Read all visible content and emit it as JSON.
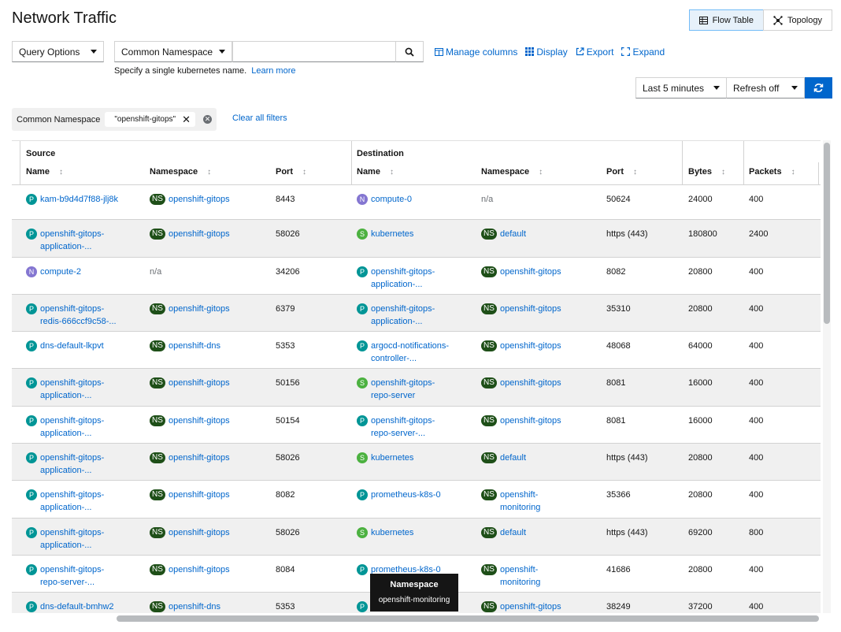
{
  "page": {
    "title": "Network Traffic"
  },
  "views": {
    "flow_table": "Flow Table",
    "topology": "Topology"
  },
  "toolbar": {
    "query_options": "Query Options",
    "filter_field": "Common Namespace",
    "search_value": "",
    "helper_text": "Specify a single kubernetes name.",
    "learn_more": "Learn more",
    "manage_columns": "Manage columns",
    "display": "Display",
    "export": "Export",
    "expand": "Expand"
  },
  "time": {
    "range": "Last 5 minutes",
    "refresh": "Refresh off"
  },
  "filters": {
    "group_label": "Common Namespace",
    "chip_value": "\"openshift-gitops\"",
    "clear_all": "Clear all filters"
  },
  "table": {
    "group_source": "Source",
    "group_destination": "Destination",
    "headers": {
      "src_name": "Name",
      "src_ns": "Namespace",
      "src_port": "Port",
      "dst_name": "Name",
      "dst_ns": "Namespace",
      "dst_port": "Port",
      "bytes": "Bytes",
      "packets": "Packets"
    },
    "rows": [
      {
        "src_type": "P",
        "src_name": [
          "kam-b9d4d7f88-jlj8k"
        ],
        "src_ns": [
          "openshift-gitops"
        ],
        "src_port": "8443",
        "dst_type": "N",
        "dst_name": [
          "compute-0"
        ],
        "dst_ns": null,
        "dst_port": "50624",
        "bytes": "24000",
        "packets": "400"
      },
      {
        "src_type": "P",
        "src_name": [
          "openshift-gitops-",
          "application-..."
        ],
        "src_ns": [
          "openshift-gitops"
        ],
        "src_port": "58026",
        "dst_type": "S",
        "dst_name": [
          "kubernetes"
        ],
        "dst_ns": [
          "default"
        ],
        "dst_port": "https (443)",
        "bytes": "180800",
        "packets": "2400"
      },
      {
        "src_type": "N",
        "src_name": [
          "compute-2"
        ],
        "src_ns": null,
        "src_port": "34206",
        "dst_type": "P",
        "dst_name": [
          "openshift-gitops-",
          "application-..."
        ],
        "dst_ns": [
          "openshift-gitops"
        ],
        "dst_port": "8082",
        "bytes": "20800",
        "packets": "400"
      },
      {
        "src_type": "P",
        "src_name": [
          "openshift-gitops-",
          "redis-666ccf9c58-..."
        ],
        "src_ns": [
          "openshift-gitops"
        ],
        "src_port": "6379",
        "dst_type": "P",
        "dst_name": [
          "openshift-gitops-",
          "application-..."
        ],
        "dst_ns": [
          "openshift-gitops"
        ],
        "dst_port": "35310",
        "bytes": "20800",
        "packets": "400"
      },
      {
        "src_type": "P",
        "src_name": [
          "dns-default-lkpvt"
        ],
        "src_ns": [
          "openshift-dns"
        ],
        "src_port": "5353",
        "dst_type": "P",
        "dst_name": [
          "argocd-notifications-",
          "controller-..."
        ],
        "dst_ns": [
          "openshift-gitops"
        ],
        "dst_port": "48068",
        "bytes": "64000",
        "packets": "400"
      },
      {
        "src_type": "P",
        "src_name": [
          "openshift-gitops-",
          "application-..."
        ],
        "src_ns": [
          "openshift-gitops"
        ],
        "src_port": "50156",
        "dst_type": "S",
        "dst_name": [
          "openshift-gitops-",
          "repo-server"
        ],
        "dst_ns": [
          "openshift-gitops"
        ],
        "dst_port": "8081",
        "bytes": "16000",
        "packets": "400"
      },
      {
        "src_type": "P",
        "src_name": [
          "openshift-gitops-",
          "application-..."
        ],
        "src_ns": [
          "openshift-gitops"
        ],
        "src_port": "50154",
        "dst_type": "P",
        "dst_name": [
          "openshift-gitops-",
          "repo-server-..."
        ],
        "dst_ns": [
          "openshift-gitops"
        ],
        "dst_port": "8081",
        "bytes": "16000",
        "packets": "400"
      },
      {
        "src_type": "P",
        "src_name": [
          "openshift-gitops-",
          "application-..."
        ],
        "src_ns": [
          "openshift-gitops"
        ],
        "src_port": "58026",
        "dst_type": "S",
        "dst_name": [
          "kubernetes"
        ],
        "dst_ns": [
          "default"
        ],
        "dst_port": "https (443)",
        "bytes": "20800",
        "packets": "400"
      },
      {
        "src_type": "P",
        "src_name": [
          "openshift-gitops-",
          "application-..."
        ],
        "src_ns": [
          "openshift-gitops"
        ],
        "src_port": "8082",
        "dst_type": "P",
        "dst_name": [
          "prometheus-k8s-0"
        ],
        "dst_ns": [
          "openshift-",
          "monitoring"
        ],
        "dst_port": "35366",
        "bytes": "20800",
        "packets": "400"
      },
      {
        "src_type": "P",
        "src_name": [
          "openshift-gitops-",
          "application-..."
        ],
        "src_ns": [
          "openshift-gitops"
        ],
        "src_port": "58026",
        "dst_type": "S",
        "dst_name": [
          "kubernetes"
        ],
        "dst_ns": [
          "default"
        ],
        "dst_port": "https (443)",
        "bytes": "69200",
        "packets": "800"
      },
      {
        "src_type": "P",
        "src_name": [
          "openshift-gitops-",
          "repo-server-..."
        ],
        "src_ns": [
          "openshift-gitops"
        ],
        "src_port": "8084",
        "dst_type": "P",
        "dst_name": [
          "prometheus-k8s-0"
        ],
        "dst_ns": [
          "openshift-",
          "monitoring"
        ],
        "dst_port": "41686",
        "bytes": "20800",
        "packets": "400"
      },
      {
        "src_type": "P",
        "src_name": [
          "dns-default-bmhw2"
        ],
        "src_ns": [
          "openshift-dns"
        ],
        "src_port": "5353",
        "dst_type": "P",
        "dst_name": [
          ""
        ],
        "dst_ns": [
          "openshift-gitops"
        ],
        "dst_port": "38249",
        "bytes": "37200",
        "packets": "400"
      }
    ],
    "na_text": "n/a",
    "ns_badge": "NS"
  },
  "tooltip": {
    "title": "Namespace",
    "value": "openshift-monitoring"
  }
}
